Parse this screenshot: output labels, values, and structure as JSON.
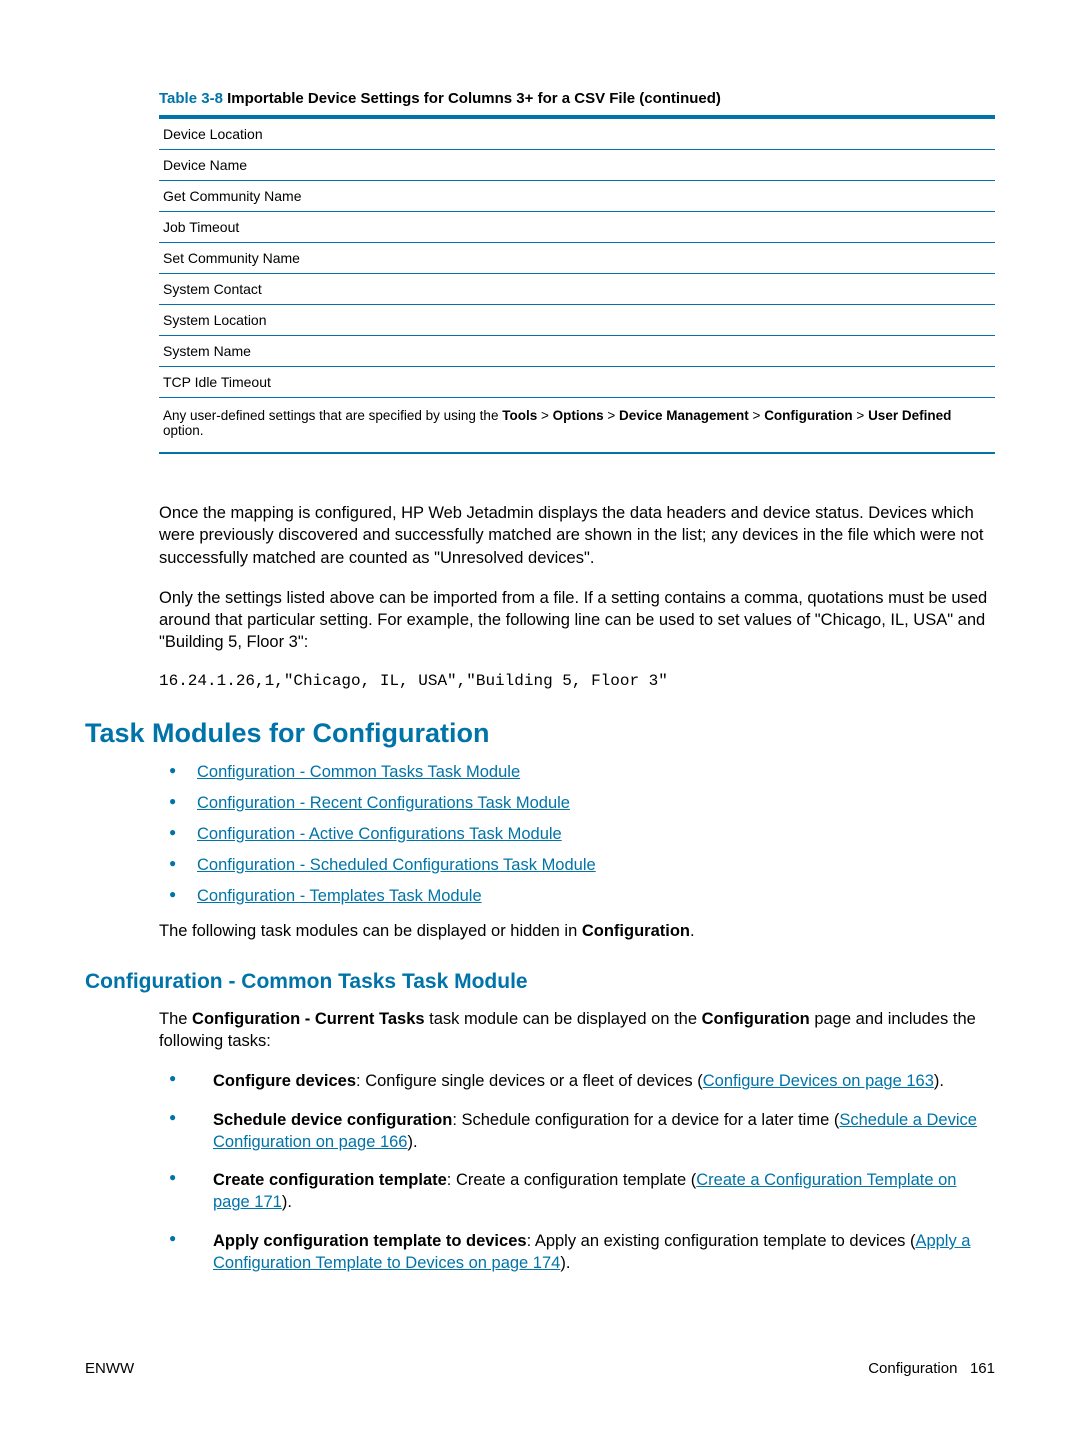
{
  "table": {
    "label": "Table 3-8",
    "title": "  Importable Device Settings for Columns 3+ for a CSV File (continued)",
    "rows": [
      "Device Location",
      "Device Name",
      "Get Community Name",
      "Job Timeout",
      "Set Community Name",
      "System Contact",
      "System Location",
      "System Name",
      "TCP Idle Timeout"
    ],
    "note_pre": "Any user-defined settings that are specified by using the ",
    "note_bold_parts": [
      "Tools",
      "Options",
      "Device Management",
      "Configuration",
      "User Defined"
    ],
    "note_sep": " > ",
    "note_post": " option."
  },
  "para1": "Once the mapping is configured, HP Web Jetadmin displays the data headers and device status. Devices which were previously discovered and successfully matched are shown in the list; any devices in the file which were not successfully matched are counted as \"Unresolved devices\".",
  "para2": "Only the settings listed above can be imported from a file. If a setting contains a comma, quotations must be used around that particular setting. For example, the following line can be used to set values of \"Chicago, IL, USA\" and \"Building 5, Floor 3\":",
  "code": "16.24.1.26,1,\"Chicago, IL, USA\",\"Building 5, Floor 3\"",
  "section_heading": "Task Modules for Configuration",
  "link_list": [
    "Configuration - Common Tasks Task Module",
    "Configuration - Recent Configurations Task Module",
    "Configuration - Active Configurations Task Module",
    "Configuration - Scheduled Configurations Task Module",
    "Configuration - Templates Task Module"
  ],
  "para3_pre": "The following task modules can be displayed or hidden in ",
  "para3_bold": "Configuration",
  "para3_post": ".",
  "subsection_heading": "Configuration - Common Tasks Task Module",
  "para4_pre1": "The ",
  "para4_bold1": "Configuration - Current Tasks",
  "para4_mid": " task module can be displayed on the ",
  "para4_bold2": "Configuration",
  "para4_post": " page and includes the following tasks:",
  "bullets": [
    {
      "bold": "Configure devices",
      "text": ": Configure single devices or a fleet of devices (",
      "link": "Configure Devices on page 163",
      "after": ")."
    },
    {
      "bold": "Schedule device configuration",
      "text": ": Schedule configuration for a device for a later time (",
      "link": "Schedule a Device Configuration on page 166",
      "after": ")."
    },
    {
      "bold": "Create configuration template",
      "text": ": Create a configuration template (",
      "link": "Create a Configuration Template on page 171",
      "after": ")."
    },
    {
      "bold": "Apply configuration template to devices",
      "text": ": Apply an existing configuration template to devices (",
      "link": "Apply a Configuration Template to Devices on page 174",
      "after": ")."
    }
  ],
  "footer": {
    "left": "ENWW",
    "right_label": "Configuration",
    "right_page": "161"
  }
}
